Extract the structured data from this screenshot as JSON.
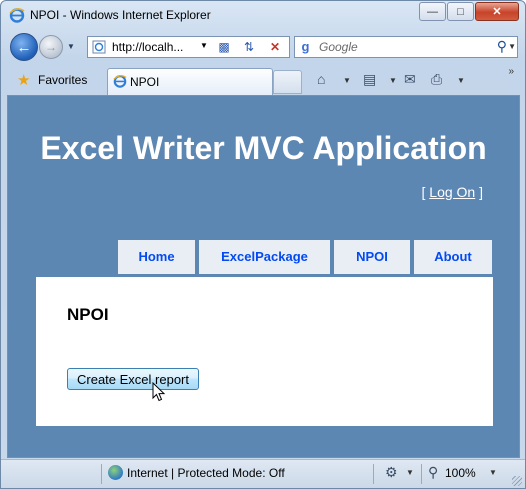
{
  "window": {
    "title": "NPOI - Windows Internet Explorer",
    "minimize_icon": "minimize-icon",
    "maximize_icon": "maximize-icon",
    "close_icon": "close-icon"
  },
  "navbar": {
    "back_icon": "back-arrow-icon",
    "forward_icon": "forward-arrow-icon",
    "address": "http://localh...",
    "search_provider": "Google",
    "search_placeholder": "Google"
  },
  "favorites_bar": {
    "favorites_label": "Favorites",
    "tab_label": "NPOI"
  },
  "page": {
    "site_title": "Excel Writer MVC Application",
    "login_open": "[",
    "login_link": "Log On",
    "login_close": "]",
    "menu": [
      {
        "label": "Home"
      },
      {
        "label": "ExcelPackage"
      },
      {
        "label": "NPOI"
      },
      {
        "label": "About"
      }
    ],
    "heading": "NPOI",
    "button_label": "Create Excel report"
  },
  "statusbar": {
    "zone_text": "Internet | Protected Mode: Off",
    "zoom": "100%"
  },
  "colors": {
    "page_background": "#5c87b2",
    "menu_tab_bg": "#e8eef4",
    "menu_link": "#034af3"
  }
}
